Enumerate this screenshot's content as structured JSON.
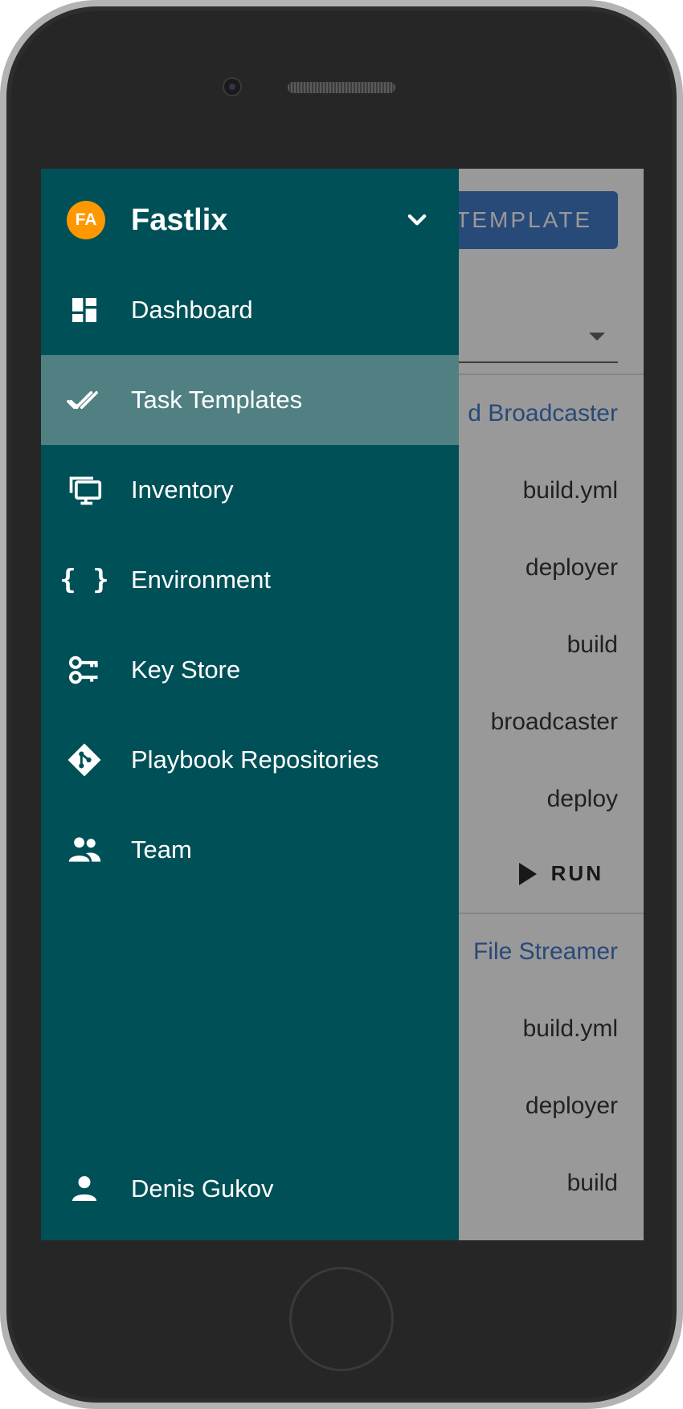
{
  "background": {
    "new_template_label": "TEMPLATE",
    "templates": [
      {
        "title": "d Broadcaster",
        "rows": [
          "build.yml",
          "deployer",
          "build",
          "broadcaster",
          "deploy"
        ],
        "run_label": "RUN"
      },
      {
        "title": "File Streamer",
        "rows": [
          "build.yml",
          "deployer",
          "build"
        ]
      }
    ]
  },
  "drawer": {
    "project_initials": "FA",
    "project_name": "Fastlix",
    "items": [
      {
        "label": "Dashboard",
        "icon": "dashboard-icon"
      },
      {
        "label": "Task Templates",
        "icon": "double-check-icon",
        "active": true
      },
      {
        "label": "Inventory",
        "icon": "monitor-icon"
      },
      {
        "label": "Environment",
        "icon": "code-braces-icon"
      },
      {
        "label": "Key Store",
        "icon": "key-icon"
      },
      {
        "label": "Playbook Repositories",
        "icon": "git-icon"
      },
      {
        "label": "Team",
        "icon": "team-icon"
      }
    ],
    "user_name": "Denis Gukov",
    "colors": {
      "drawer_bg": "#005057",
      "active_bg": "#508082",
      "avatar_bg": "#ff9800",
      "accent": "#2f6ec4"
    }
  }
}
